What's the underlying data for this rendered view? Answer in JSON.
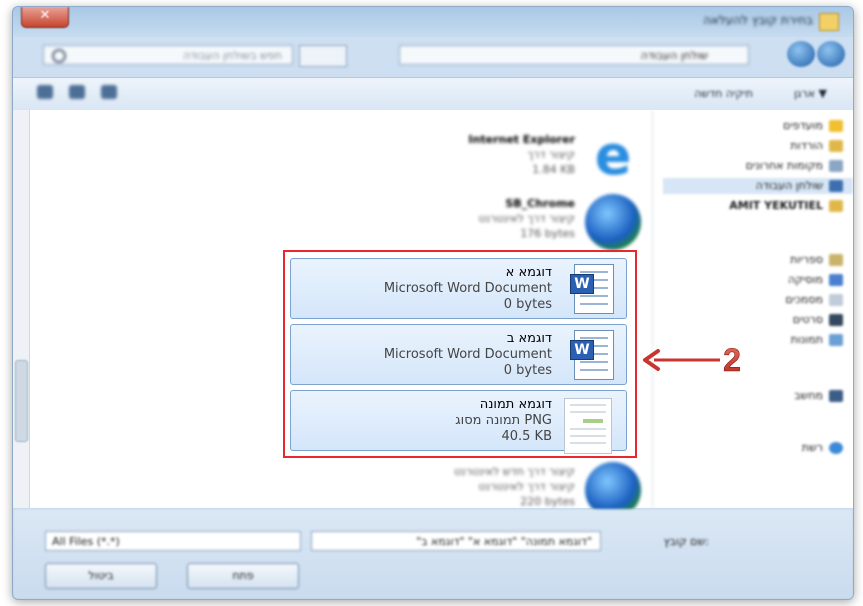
{
  "window": {
    "title": "בחירת קובץ להעלאה",
    "close_glyph": "✕"
  },
  "address_bar": {
    "path": "שולחן העבודה",
    "search_placeholder": "חפש בשולחן העבודה"
  },
  "toolbar": {
    "organize_label": "ארגן ▼",
    "new_folder_label": "תיקיה חדשה"
  },
  "nav_pane": {
    "favorites": [
      "מועדפים",
      "הורדות",
      "מקומות אחרונים",
      "שולחן העבודה",
      "AMIT YEKUTIEL"
    ],
    "libraries": [
      "ספריות",
      "מוסיקה",
      "מסמכים",
      "סרטים",
      "תמונות"
    ],
    "computer": "מחשב",
    "network": "רשת"
  },
  "blurred_files": [
    {
      "name": "Internet Explorer",
      "type": "קיצור דרך",
      "size": "1.84 KB",
      "icon": "ie-icon"
    },
    {
      "name": "SB_Chrome",
      "type": "קיצור דרך לאינטרנט",
      "size": "176 bytes",
      "icon": "globe-icon"
    },
    {
      "name": "קיצור דרך חדש לאינטרנט",
      "type": "קיצור דרך לאינטרנט",
      "size": "220 bytes",
      "icon": "globe-icon"
    }
  ],
  "highlighted_files": [
    {
      "name": "דוגמא א",
      "type": "Microsoft Word Document",
      "size": "0 bytes",
      "icon": "word-doc-icon"
    },
    {
      "name": "דוגמא ב",
      "type": "Microsoft Word Document",
      "size": "0 bytes",
      "icon": "word-doc-icon"
    },
    {
      "name": "דוגמא תמונה",
      "type": "תמונה מסוג PNG",
      "size": "40.5 KB",
      "icon": "png-thumbnail-icon"
    }
  ],
  "annotation": {
    "number": "2",
    "color": "#c8352f"
  },
  "bottom": {
    "file_name_label": "שם קובץ:",
    "file_name_value": "\"דוגמא תמונה\" \"דוגמא א\" \"דוגמא ב\"",
    "file_type_value": "All Files (*.*)",
    "open_button": "פתח",
    "cancel_button": "ביטול"
  }
}
